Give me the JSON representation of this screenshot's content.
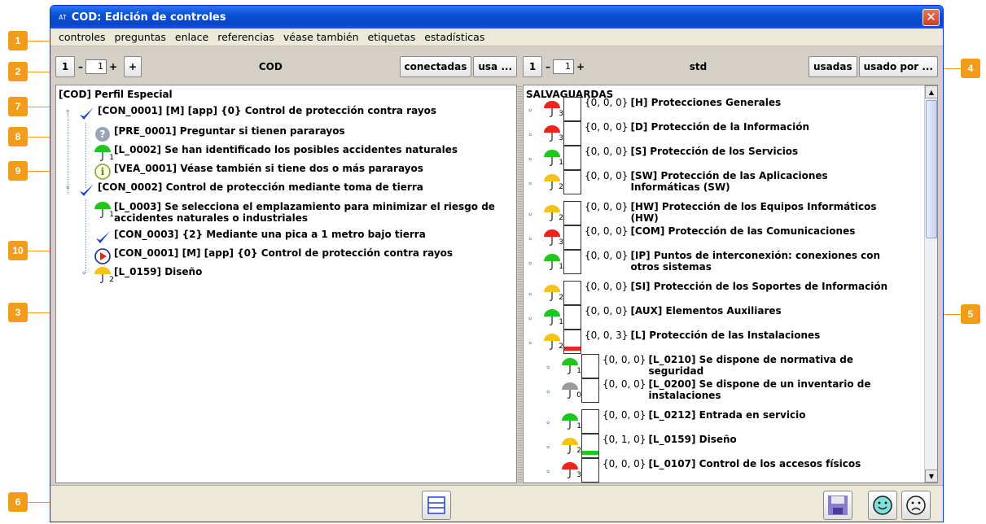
{
  "window": {
    "title": "COD: Edición de controles",
    "badge": "AT",
    "close_label": "✕"
  },
  "menu": [
    "controles",
    "preguntas",
    "enlace",
    "referencias",
    "véase también",
    "etiquetas",
    "estadísticas"
  ],
  "left_toolbar": {
    "btn_1": "1",
    "minus": "–",
    "spin_value": "1",
    "plus": "+",
    "btn_plus": "+",
    "title": "COD",
    "btn_conectadas": "conectadas",
    "btn_usa": "usa ..."
  },
  "right_toolbar": {
    "btn_1": "1",
    "minus": "–",
    "spin_value": "1",
    "plus": "+",
    "title": "std",
    "btn_usadas": "usadas",
    "btn_usado_por": "usado por ..."
  },
  "left_tree": {
    "root": "[COD] Perfil Especial",
    "items": [
      {
        "icon": "check-icon",
        "text": "[CON_0001] [M] [app] {0} Control de protección contra rayos"
      },
      {
        "icon": "question-icon",
        "text": "[PRE_0001] Preguntar si tienen pararayos"
      },
      {
        "icon": "umbrella-green-icon",
        "level": "1",
        "text": "[L_0002] Se han identificado los posibles accidentes naturales"
      },
      {
        "icon": "info-icon",
        "text": "[VEA_0001] Véase también si tiene dos o más pararayos"
      },
      {
        "icon": "check-icon",
        "text": "[CON_0002] Control de protección mediante toma de tierra"
      },
      {
        "icon": "umbrella-green-icon",
        "level": "1",
        "text": "[L_0003] Se selecciona el emplazamiento para minimizar el riesgo de accidentes naturales o industriales"
      },
      {
        "icon": "check-icon",
        "text": "[CON_0003] {2} Mediante una pica a 1 metro bajo tierra"
      },
      {
        "icon": "play-icon",
        "text": "[CON_0001] [M] [app] {0} Control de protección contra rayos"
      },
      {
        "icon": "umbrella-yellow-icon",
        "level": "2",
        "text": "[L_0159] Diseño"
      }
    ]
  },
  "right_tree": {
    "root": "SALVAGUARDAS",
    "items": [
      {
        "color": "#e8261c",
        "level": "3",
        "counts": "{0, 0, 0}",
        "text": "[H] Protecciones Generales"
      },
      {
        "color": "#e8261c",
        "level": "3",
        "counts": "{0, 0, 0}",
        "text": "[D] Protección de la Información"
      },
      {
        "color": "#22c41e",
        "level": "1",
        "counts": "{0, 0, 0}",
        "text": "[S] Protección de los Servicios"
      },
      {
        "color": "#f5c21a",
        "level": "2",
        "counts": "{0, 0, 0}",
        "text": "[SW] Protección de las Aplicaciones Informáticas (SW)"
      },
      {
        "color": "#f5c21a",
        "level": "2",
        "counts": "{0, 0, 0}",
        "text": "[HW] Protección de los Equipos Informáticos (HW)"
      },
      {
        "color": "#e8261c",
        "level": "3",
        "counts": "{0, 0, 0}",
        "text": "[COM] Protección de las Comunicaciones"
      },
      {
        "color": "#22c41e",
        "level": "1",
        "counts": "{0, 0, 0}",
        "text": "[IP] Puntos de interconexión: conexiones con otros sistemas"
      },
      {
        "color": "#f5c21a",
        "level": "2",
        "counts": "{0, 0, 0}",
        "text": "[SI] Protección de los Soportes de Información"
      },
      {
        "color": "#22c41e",
        "level": "1",
        "counts": "{0, 0, 0}",
        "text": "[AUX] Elementos Auxiliares"
      },
      {
        "color": "#f5c21a",
        "level": "2",
        "counts": "{0, 0, 3}",
        "text": "[L] Protección de las Instalaciones",
        "bar": "#e8261c"
      },
      {
        "color": "#22c41e",
        "level": "1",
        "counts": "{0, 0, 0}",
        "text": "[L_0210] Se dispone de normativa de seguridad"
      },
      {
        "color": "#9a9a9a",
        "level": "0",
        "counts": "{0, 0, 0}",
        "text": "[L_0200] Se dispone de un inventario de instalaciones"
      },
      {
        "color": "#22c41e",
        "level": "1",
        "counts": "{0, 0, 0}",
        "text": "[L_0212] Entrada en servicio"
      },
      {
        "color": "#f5c21a",
        "level": "2",
        "counts": "{0, 1, 0}",
        "text": "[L_0159] Diseño",
        "bar": "#22c41e"
      },
      {
        "color": "#e8261c",
        "level": "3",
        "counts": "{0, 0, 0}",
        "text": "[L_0107] Control de los accesos físicos"
      }
    ]
  },
  "callouts": [
    "1",
    "2",
    "3",
    "4",
    "5",
    "6",
    "7",
    "8",
    "9",
    "10"
  ]
}
